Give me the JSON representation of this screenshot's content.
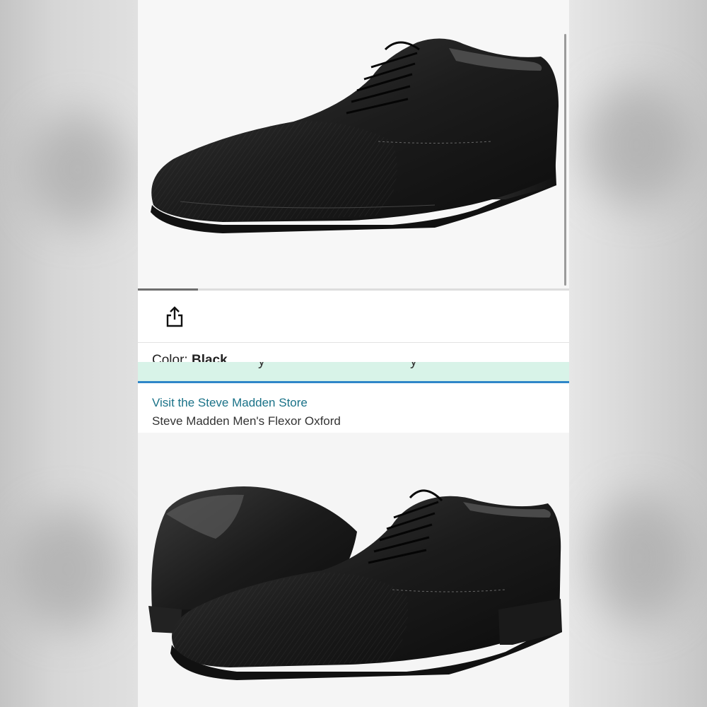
{
  "product": {
    "color_label": "Color:",
    "color_value": "Black",
    "store_link": "Visit the Steve Madden Store",
    "title": "Steve Madden Men's Flexor Oxford"
  },
  "carousel": {
    "progress_fraction": 0.14,
    "images": [
      "shoe-single-side-view",
      "shoe-pair-view"
    ]
  },
  "icons": {
    "share": "share-icon"
  },
  "colors": {
    "store_link": "#1a7288",
    "deal_banner": "#d8f3e8",
    "accent_line": "#2f86c8"
  }
}
